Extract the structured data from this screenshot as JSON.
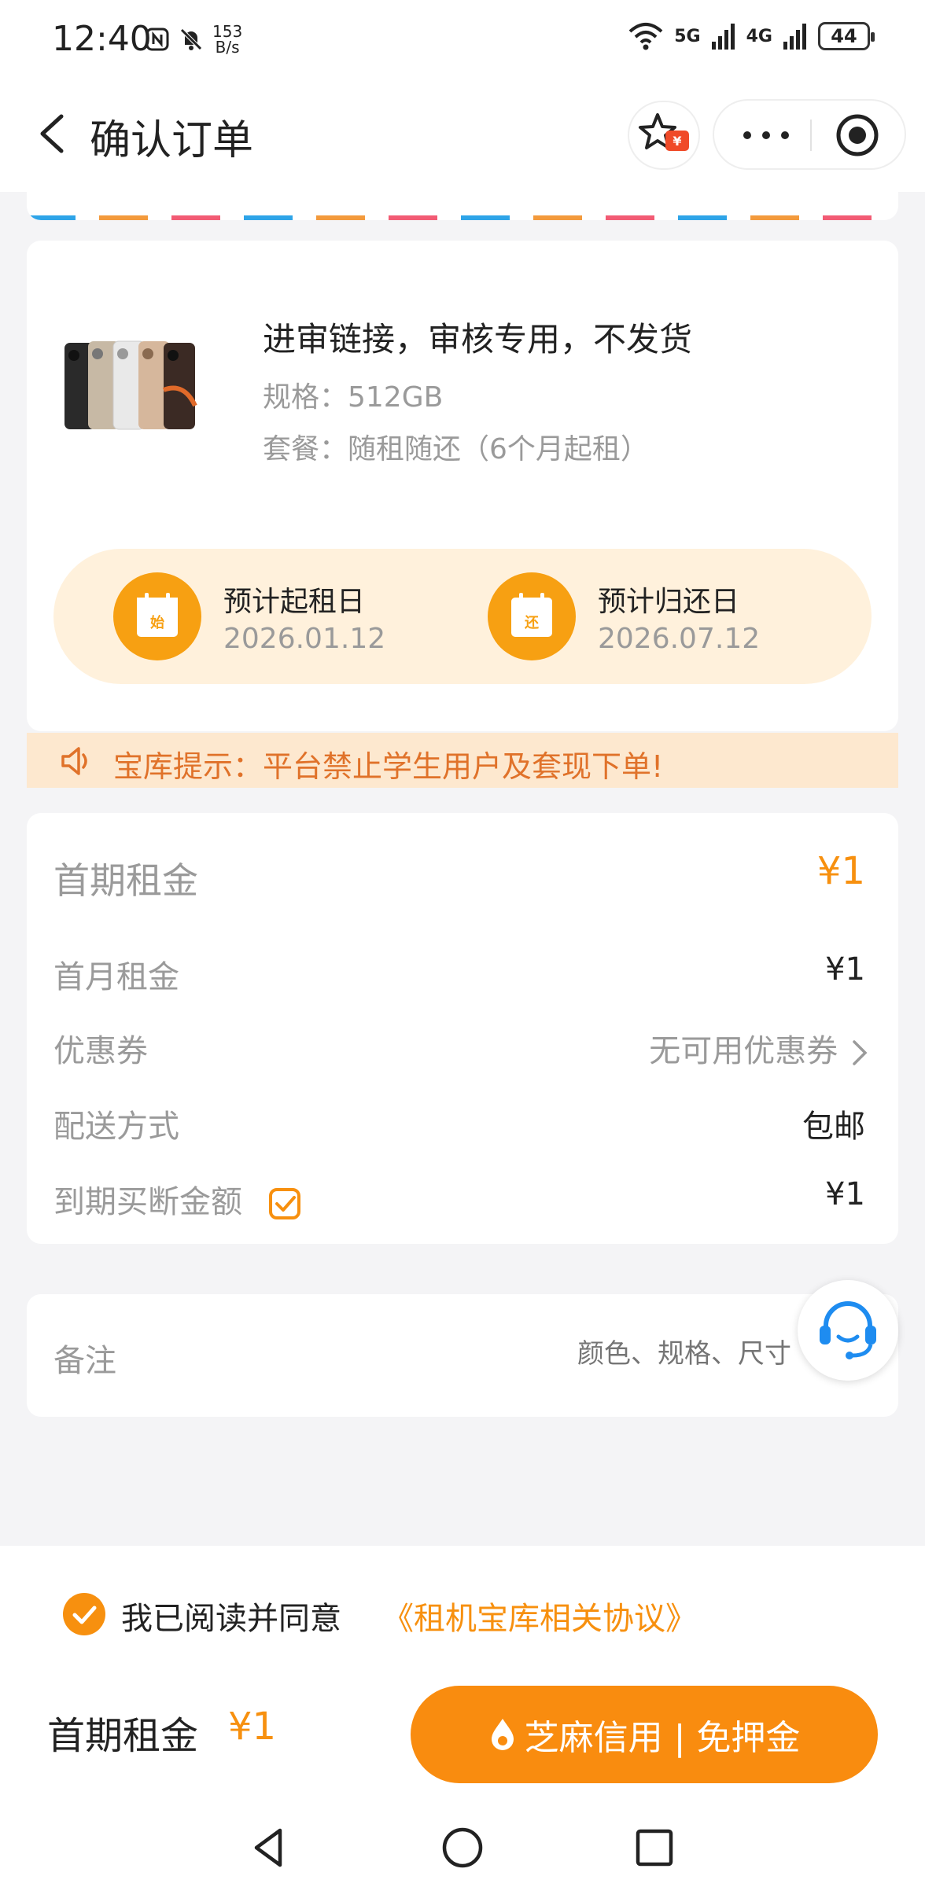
{
  "status_bar": {
    "time": "12:40",
    "speed_value": "153",
    "speed_unit": "B/s",
    "net1": "5G",
    "net2": "4G",
    "battery": "44"
  },
  "nav": {
    "title": "确认订单",
    "fav_badge": "¥"
  },
  "product": {
    "title": "进审链接，审核专用，不发货",
    "spec": "规格：512GB",
    "plan": "套餐：随租随还（6个月起租）",
    "start": {
      "icon_char": "始",
      "label": "预计起租日",
      "date": "2026.01.12"
    },
    "end": {
      "icon_char": "还",
      "label": "预计归还日",
      "date": "2026.07.12"
    }
  },
  "notice": {
    "text": "宝库提示：平台禁止学生用户及套现下单!"
  },
  "pricing": {
    "rows": [
      {
        "label": "首期租金",
        "value": "¥1"
      },
      {
        "label": "首月租金",
        "value": "¥1"
      },
      {
        "label": "优惠券",
        "value": "无可用优惠券"
      },
      {
        "label": "配送方式",
        "value": "包邮"
      },
      {
        "label": "到期买断金额",
        "value": "¥1"
      }
    ]
  },
  "remark": {
    "label": "备注",
    "placeholder": "颜色、规格、尺寸"
  },
  "agreement": {
    "text": "我已阅读并同意",
    "link": "《租机宝库相关协议》"
  },
  "footer": {
    "label": "首期租金",
    "price": "¥1",
    "button": "芝麻信用 | 免押金"
  },
  "colors": {
    "accent": "#f7900f",
    "notice_bg": "#fde8cf",
    "date_pill_bg": "#fff1dc"
  }
}
